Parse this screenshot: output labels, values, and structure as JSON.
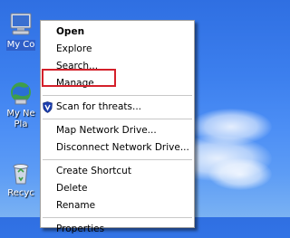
{
  "desktop": {
    "icons": [
      {
        "label": "My Co",
        "icon": "my-computer-icon",
        "selected": true
      },
      {
        "label_line1": "My Ne",
        "label_line2": "Pla",
        "icon": "my-network-places-icon"
      },
      {
        "label": "Recyc",
        "icon": "recycle-bin-icon"
      }
    ]
  },
  "context_menu": {
    "items": [
      {
        "label": "Open",
        "bold": true
      },
      {
        "label": "Explore"
      },
      {
        "label": "Search..."
      },
      {
        "label": "Manage",
        "highlighted": true
      },
      {
        "label": "Scan for threats...",
        "icon": "security-shield-icon"
      },
      {
        "label": "Map Network Drive..."
      },
      {
        "label": "Disconnect Network Drive..."
      },
      {
        "label": "Create Shortcut"
      },
      {
        "label": "Delete"
      },
      {
        "label": "Rename"
      },
      {
        "label": "Properties"
      }
    ]
  },
  "colors": {
    "highlight_border": "#d4202a",
    "desktop_blue": "#3c7fee"
  }
}
